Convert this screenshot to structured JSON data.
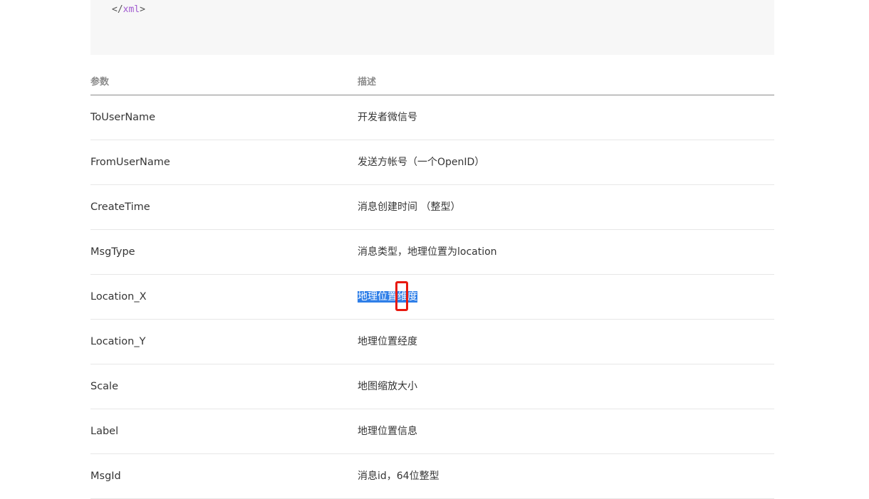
{
  "code": {
    "open": "</",
    "tag": "xml",
    "close": ">"
  },
  "table": {
    "headers": [
      "参数",
      "描述"
    ],
    "rows": [
      {
        "name": "ToUserName",
        "desc": "开发者微信号"
      },
      {
        "name": "FromUserName",
        "desc": "发送方帐号（一个OpenID）"
      },
      {
        "name": "CreateTime",
        "desc": "消息创建时间 （整型）"
      },
      {
        "name": "MsgType",
        "desc": "消息类型，地理位置为location"
      },
      {
        "name": "Location_X",
        "desc": "地理位置维度"
      },
      {
        "name": "Location_Y",
        "desc": "地理位置经度"
      },
      {
        "name": "Scale",
        "desc": "地图缩放大小"
      },
      {
        "name": "Label",
        "desc": "地理位置信息"
      },
      {
        "name": "MsgId",
        "desc": "消息id，64位整型"
      }
    ]
  },
  "colors": {
    "selection": "#2f7fe8",
    "highlight_box": "#e8190f",
    "xml_tag": "#a05ad0"
  }
}
